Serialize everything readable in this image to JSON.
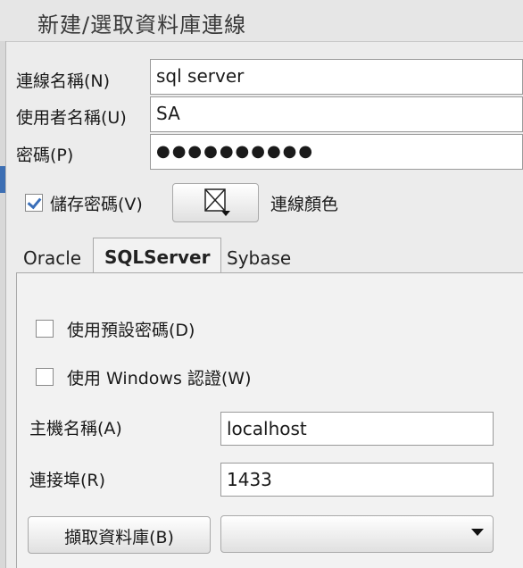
{
  "title": "新建/選取資料庫連線",
  "connection": {
    "name_label": "連線名稱(N)",
    "name_value": "sql server",
    "user_label": "使用者名稱(U)",
    "user_value": "SA",
    "password_label": "密碼(P)",
    "password_value": "●●●●●●●●●●",
    "save_password_label": "儲存密碼(V)",
    "save_password_checked": true,
    "color_label": "連線顏色"
  },
  "tabs": [
    {
      "label": "Oracle",
      "active": false
    },
    {
      "label": "SQLServer",
      "active": true
    },
    {
      "label": "Sybase",
      "active": false
    }
  ],
  "sqlserver": {
    "use_default_password_label": "使用預設密碼(D)",
    "use_windows_auth_label": "使用 Windows 認證(W)",
    "host_label": "主機名稱(A)",
    "host_value": "localhost",
    "port_label": "連接埠(R)",
    "port_value": "1433",
    "fetch_db_button": "擷取資料庫(B)",
    "database_value": ""
  },
  "colors": {
    "accent": "#3a6fb9"
  }
}
